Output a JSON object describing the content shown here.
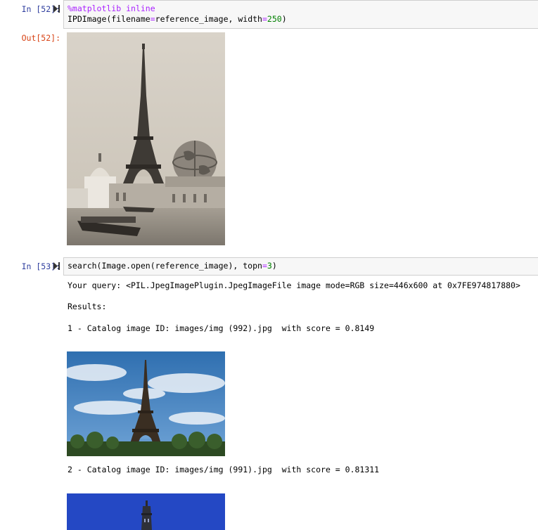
{
  "cells": [
    {
      "in_prompt": "In [52]:",
      "out_prompt": "Out[52]:",
      "code": {
        "line1_magic": "%matplotlib inline",
        "line2_pre": "IPDImage(filename",
        "line2_eq": "=",
        "line2_mid": "reference_image, width",
        "line2_eq2": "=",
        "line2_num": "250",
        "line2_post": ")"
      },
      "output_image_icon": "vintage-eiffel-tower-photo"
    },
    {
      "in_prompt": "In [53]:",
      "code": {
        "pre": "search(Image.open(reference_image), topn",
        "eq": "=",
        "num": "3",
        "post": ")"
      },
      "output": {
        "query_line": "Your query: <PIL.JpegImagePlugin.JpegImageFile image mode=RGB size=446x600 at 0x7FE974817880>",
        "results_label": "Results:",
        "results": [
          {
            "line": "1 - Catalog image ID: images/img (992).jpg  with score = 0.8149",
            "image_icon": "eiffel-tower-cloudy-sky-photo"
          },
          {
            "line": "2 - Catalog image ID: images/img (991).jpg  with score = 0.81311",
            "image_icon": "eiffel-tower-blue-sky-photo"
          }
        ]
      }
    }
  ],
  "colors": {
    "in_prompt": "#303f9f",
    "out_prompt": "#d84315",
    "cell_background": "#f7f7f7",
    "magic": "#aa22ff",
    "number": "#008000"
  }
}
